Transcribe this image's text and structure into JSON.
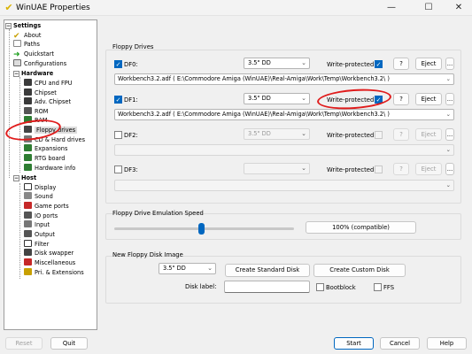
{
  "window": {
    "title": "WinUAE Properties",
    "minimize": "—",
    "maximize": "☐",
    "close": "✕"
  },
  "tree": {
    "settings": "Settings",
    "about": "About",
    "paths": "Paths",
    "quickstart": "Quickstart",
    "configurations": "Configurations",
    "hardware": "Hardware",
    "cpu": "CPU and FPU",
    "chipset": "Chipset",
    "adv_chipset": "Adv. Chipset",
    "rom": "ROM",
    "ram": "RAM",
    "floppy": "Floppy drives",
    "cd_hard": "CD & Hard drives",
    "expansions": "Expansions",
    "rtg": "RTG board",
    "hwinfo": "Hardware info",
    "host": "Host",
    "display": "Display",
    "sound": "Sound",
    "gameports": "Game ports",
    "ioports": "IO ports",
    "input": "Input",
    "output": "Output",
    "filter": "Filter",
    "diskswapper": "Disk swapper",
    "misc": "Miscellaneous",
    "pri": "Pri. & Extensions"
  },
  "floppy": {
    "group_label": "Floppy Drives",
    "write_protected": "Write-protected",
    "q": "?",
    "eject": "Eject",
    "dots": "...",
    "drives": [
      {
        "label": "DF0:",
        "type": "3.5\" DD",
        "path": "Workbench3.2.adf ( E:\\Commodore Amiga (WinUAE)\\Real-Amiga\\Work\\Temp\\Workbench3.2\\ )"
      },
      {
        "label": "DF1:",
        "type": "3.5\" DD",
        "path": "Workbench3.2.adf ( E:\\Commodore Amiga (WinUAE)\\Real-Amiga\\Work\\Temp\\Workbench3.2\\ )"
      },
      {
        "label": "DF2:",
        "type": "3.5\" DD",
        "path": ""
      },
      {
        "label": "DF3:",
        "type": "",
        "path": ""
      }
    ]
  },
  "emu": {
    "group_label": "Floppy Drive Emulation Speed",
    "speed": "100% (compatible)"
  },
  "newdisk": {
    "group_label": "New Floppy Disk Image",
    "type": "3.5\" DD",
    "create_standard": "Create Standard Disk",
    "create_custom": "Create Custom Disk",
    "disk_label": "Disk label:",
    "bootblock": "Bootblock",
    "ffs": "FFS"
  },
  "footer": {
    "reset": "Reset",
    "quit": "Quit",
    "start": "Start",
    "cancel": "Cancel",
    "help": "Help"
  }
}
